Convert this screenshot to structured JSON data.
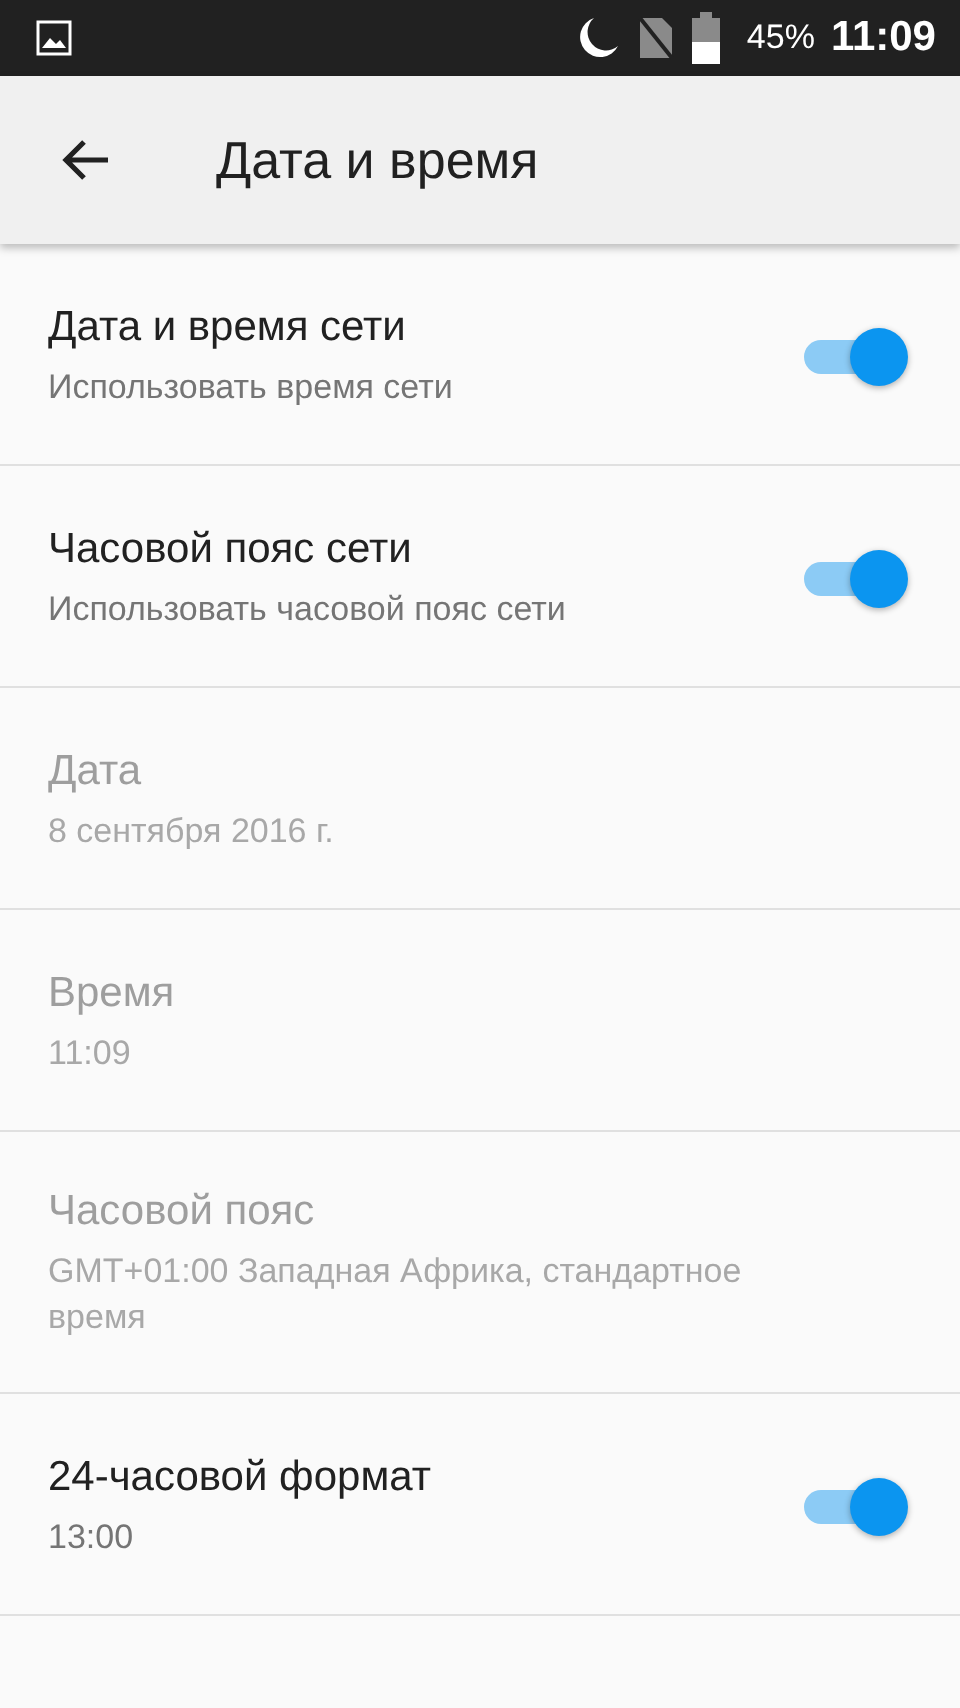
{
  "status_bar": {
    "battery": "45%",
    "time": "11:09"
  },
  "toolbar": {
    "title": "Дата и время"
  },
  "settings": [
    {
      "kind": "switch",
      "title": "Дата и время сети",
      "summary": "Использовать время сети",
      "disabled": false,
      "on": true
    },
    {
      "kind": "switch",
      "title": "Часовой пояс сети",
      "summary": "Использовать часовой пояс сети",
      "disabled": false,
      "on": true
    },
    {
      "kind": "plain",
      "title": "Дата",
      "summary": "8 сентября 2016 г.",
      "disabled": true
    },
    {
      "kind": "plain",
      "title": "Время",
      "summary": "11:09",
      "disabled": true
    },
    {
      "kind": "plain",
      "title": "Часовой пояс",
      "summary": "GMT+01:00 Западная Африка, стандартное время",
      "disabled": true
    },
    {
      "kind": "switch",
      "title": "24-часовой формат",
      "summary": "13:00",
      "disabled": false,
      "on": true
    }
  ]
}
